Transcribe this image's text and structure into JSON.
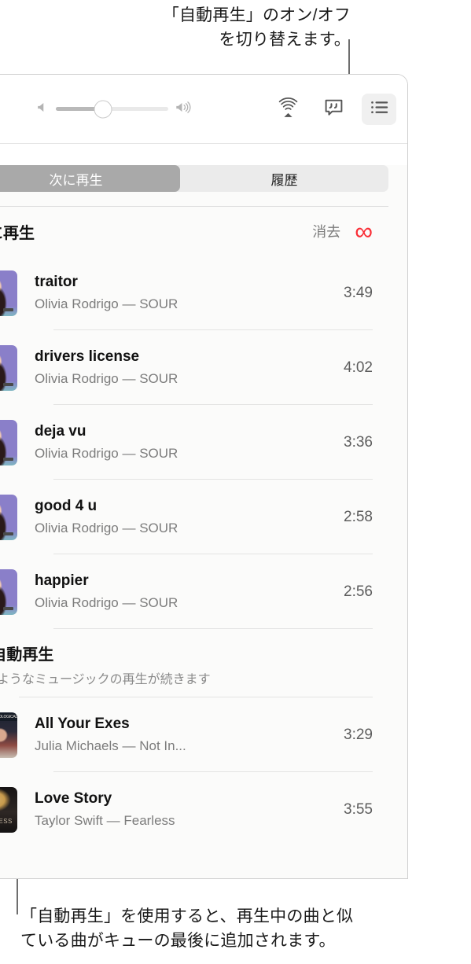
{
  "callouts": {
    "top": "「自動再生」のオン/オフ\nを切り替えます。",
    "bottom": "「自動再生」を使用すると、再生中の曲と似\nている曲がキューの最後に追加されます。"
  },
  "toolbar": {
    "volume": {
      "icon_low": "speaker-low-icon",
      "icon_high": "speaker-high-icon",
      "level_percent": 42
    },
    "buttons": [
      {
        "name": "airplay-icon",
        "label": "AirPlay"
      },
      {
        "name": "lyrics-icon",
        "label": "歌詞"
      },
      {
        "name": "queue-icon",
        "label": "再生中",
        "active": true
      }
    ]
  },
  "segmented": {
    "tabs": [
      {
        "label": "次に再生",
        "selected": true
      },
      {
        "label": "履歴",
        "selected": false
      }
    ]
  },
  "queue_header": {
    "title": "次に再生",
    "clear_label": "消去",
    "infinity_icon": "∞",
    "infinity_color": "#FA2D35"
  },
  "tracks": [
    {
      "title": "traitor",
      "subtitle": "Olivia Rodrigo — SOUR",
      "duration": "3:49",
      "art": "sour"
    },
    {
      "title": "drivers license",
      "subtitle": "Olivia Rodrigo — SOUR",
      "duration": "4:02",
      "art": "sour"
    },
    {
      "title": "deja vu",
      "subtitle": "Olivia Rodrigo — SOUR",
      "duration": "3:36",
      "art": "sour"
    },
    {
      "title": "good 4 u",
      "subtitle": "Olivia Rodrigo — SOUR",
      "duration": "2:58",
      "art": "sour"
    },
    {
      "title": "happier",
      "subtitle": "Olivia Rodrigo — SOUR",
      "duration": "2:56",
      "art": "sour"
    }
  ],
  "autoplay": {
    "infinity_icon": "∞",
    "title": "自動再生",
    "subtitle": "同じようなミュージックの再生が続きます",
    "tracks": [
      {
        "title": "All Your Exes",
        "subtitle": "Julia Michaels — Not In...",
        "duration": "3:29",
        "art": "julia",
        "art_banner": "NOT IN CHRONOLOGICAL ORDER"
      },
      {
        "title": "Love Story",
        "subtitle": "Taylor Swift — Fearless",
        "duration": "3:55",
        "art": "taylor",
        "art_caption": "FEARLESS"
      }
    ]
  }
}
